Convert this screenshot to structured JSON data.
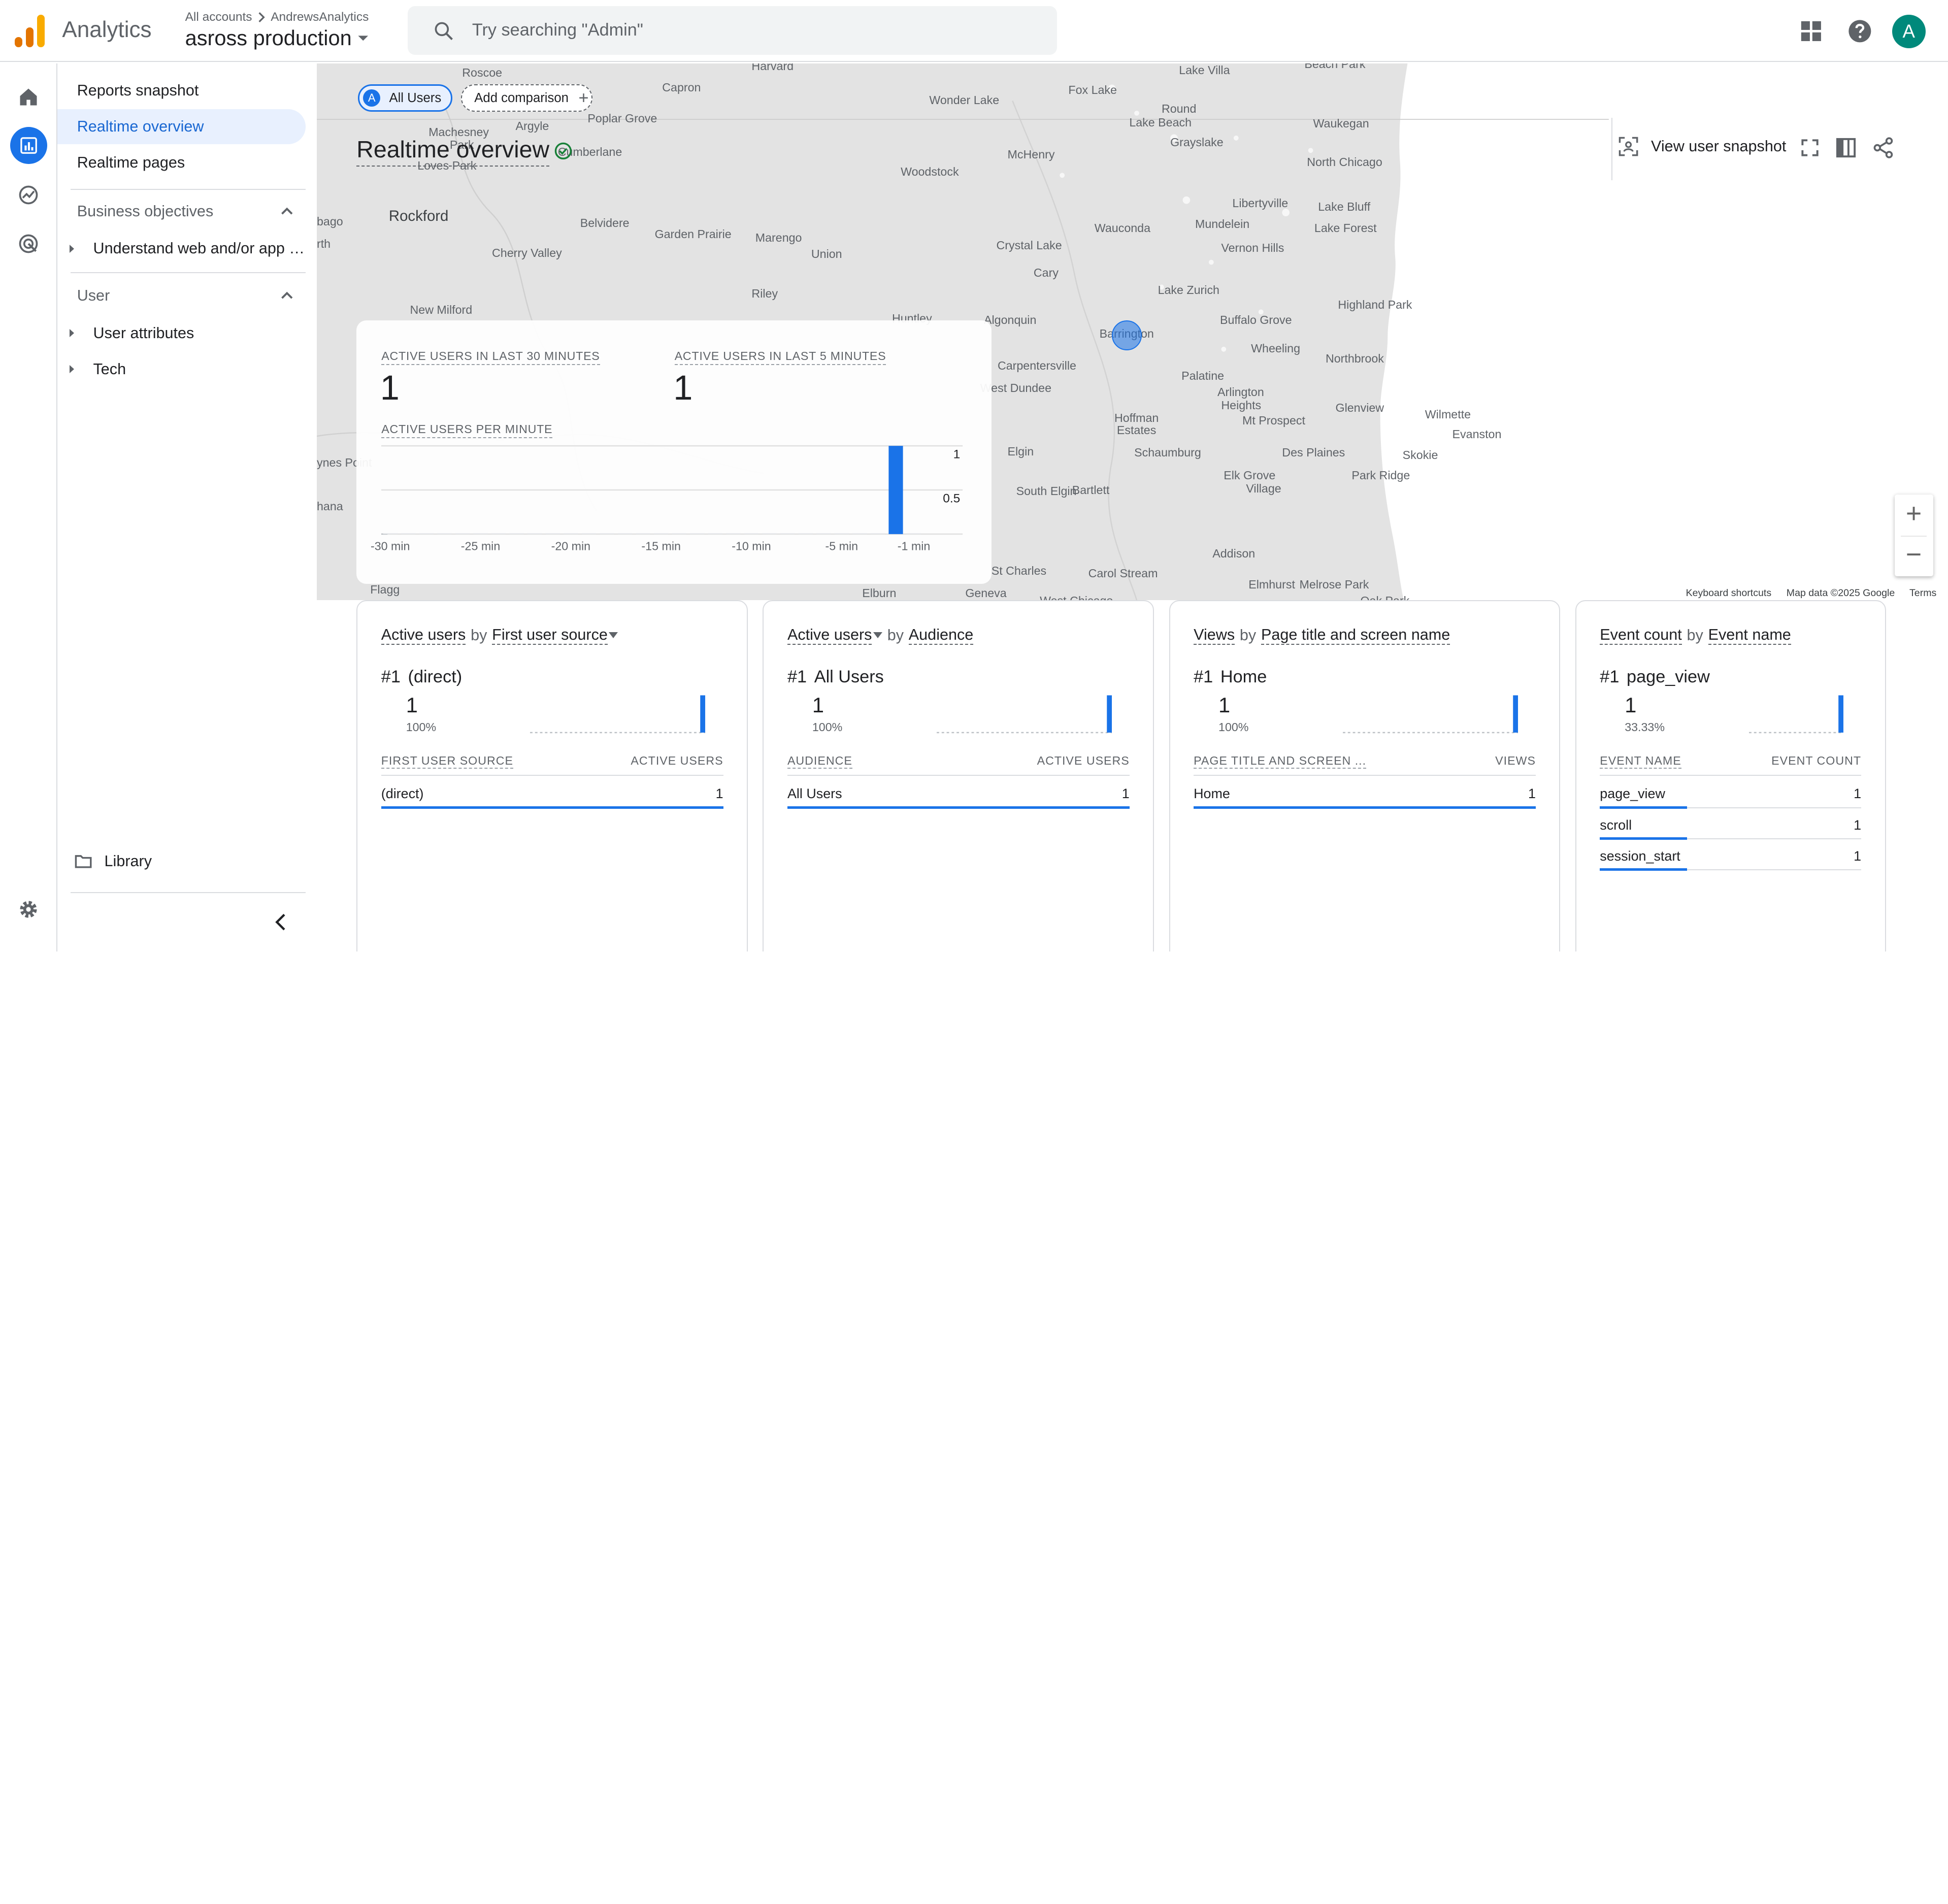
{
  "header": {
    "app_name": "Analytics",
    "breadcrumb_root": "All accounts",
    "breadcrumb_account": "AndrewsAnalytics",
    "property_name": "asross production",
    "search_placeholder": "Try searching \"Admin\"",
    "avatar_initial": "A",
    "icons": [
      "apps-grid-icon",
      "help-icon"
    ]
  },
  "rail": {
    "items": [
      "home-icon",
      "reports-icon",
      "explore-icon",
      "advertising-icon"
    ],
    "active": "reports-icon",
    "settings_icon": "gear-icon"
  },
  "nav": {
    "items": [
      "Reports snapshot",
      "Realtime overview",
      "Realtime pages"
    ],
    "active": "Realtime overview",
    "business_section": "Business objectives",
    "business_sub": [
      "Understand web and/or app t..."
    ],
    "user_section": "User",
    "user_sub": [
      "User attributes",
      "Tech"
    ],
    "library": "Library"
  },
  "comparison": {
    "segment_badge": "A",
    "segment": "All Users",
    "add": "Add comparison"
  },
  "page": {
    "title": "Realtime overview",
    "snapshot_button": "View user snapshot"
  },
  "map": {
    "labels": [
      {
        "t": "Harvard"
      },
      {
        "t": "Roscoe"
      },
      {
        "t": "Capron"
      },
      {
        "t": "Wonder Lake"
      },
      {
        "t": "Fox Lake"
      },
      {
        "t": "Lake Villa"
      },
      {
        "t": "Beach Park"
      },
      {
        "t": "Poplar Grove"
      },
      {
        "t": "Machesney"
      },
      {
        "t": "Argyle"
      },
      {
        "t": "Park"
      },
      {
        "t": "Round"
      },
      {
        "t": "Lake Beach"
      },
      {
        "t": "Waukegan"
      },
      {
        "t": "Grayslake"
      },
      {
        "t": "Cumberlane"
      },
      {
        "t": "Loves Park"
      },
      {
        "t": "McHenry"
      },
      {
        "t": "North Chicago"
      },
      {
        "t": "Woodstock"
      },
      {
        "t": "Rockford"
      },
      {
        "t": "Libertyville"
      },
      {
        "t": "Lake Bluff"
      },
      {
        "t": "Belvidere"
      },
      {
        "t": "Garden Prairie"
      },
      {
        "t": "Wauconda"
      },
      {
        "t": "Mundelein"
      },
      {
        "t": "Lake Forest"
      },
      {
        "t": "Marengo"
      },
      {
        "t": "Crystal Lake"
      },
      {
        "t": "Vernon Hills"
      },
      {
        "t": "Cherry Valley"
      },
      {
        "t": "Union"
      },
      {
        "t": "Cary"
      },
      {
        "t": "Lake Zurich"
      },
      {
        "t": "Riley"
      },
      {
        "t": "Highland Park"
      },
      {
        "t": "New Milford"
      },
      {
        "t": "Huntley"
      },
      {
        "t": "Algonquin"
      },
      {
        "t": "Buffalo Grove"
      },
      {
        "t": "Barrington"
      },
      {
        "t": "Wheeling"
      },
      {
        "t": "Northbrook"
      },
      {
        "t": "Carpentersville"
      },
      {
        "t": "Palatine"
      },
      {
        "t": "West Dundee"
      },
      {
        "t": "Arlington"
      },
      {
        "t": "Heights"
      },
      {
        "t": "Glenview"
      },
      {
        "t": "Wilmette"
      },
      {
        "t": "Hoffman"
      },
      {
        "t": "Estates"
      },
      {
        "t": "Mt Prospect"
      },
      {
        "t": "Evanston"
      },
      {
        "t": "Elgin"
      },
      {
        "t": "Schaumburg"
      },
      {
        "t": "Des Plaines"
      },
      {
        "t": "Skokie"
      },
      {
        "t": "Park Ridge"
      },
      {
        "t": "Elk Grove"
      },
      {
        "t": "Village"
      },
      {
        "t": "South Elgin"
      },
      {
        "t": "Bartlett"
      },
      {
        "t": "Addison"
      },
      {
        "t": "St Charles"
      },
      {
        "t": "Carol Stream"
      },
      {
        "t": "Elmhurst"
      },
      {
        "t": "Melrose Park"
      },
      {
        "t": "Elburn"
      },
      {
        "t": "Geneva"
      },
      {
        "t": "West Chicago"
      },
      {
        "t": "Oak Park"
      },
      {
        "t": "Flagg"
      },
      {
        "t": "ynes Point"
      },
      {
        "t": "hana"
      },
      {
        "t": "bago"
      },
      {
        "t": "rth"
      }
    ],
    "footer_shortcuts": "Keyboard shortcuts",
    "footer_data": "Map data ©2025 Google",
    "footer_terms": "Terms",
    "zoom_in": "+",
    "zoom_out": "−"
  },
  "realtime": {
    "label_30": "ACTIVE USERS IN LAST 30 MINUTES",
    "value_30": "1",
    "label_5": "ACTIVE USERS IN LAST 5 MINUTES",
    "value_5": "1",
    "label_per_minute": "ACTIVE USERS PER MINUTE",
    "colors": {
      "bar": "#1a73e8"
    }
  },
  "chart_data": {
    "type": "bar",
    "x_ticks": [
      "-30 min",
      "-25 min",
      "-20 min",
      "-15 min",
      "-10 min",
      "-5 min",
      "-1 min"
    ],
    "x": [
      -30,
      -29,
      -28,
      -27,
      -26,
      -25,
      -24,
      -23,
      -22,
      -21,
      -20,
      -19,
      -18,
      -17,
      -16,
      -15,
      -14,
      -13,
      -12,
      -11,
      -10,
      -9,
      -8,
      -7,
      -6,
      -5,
      -4,
      -3,
      -2,
      -1
    ],
    "values": [
      0,
      0,
      0,
      0,
      0,
      0,
      0,
      0,
      0,
      0,
      0,
      0,
      0,
      0,
      0,
      0,
      0,
      0,
      0,
      0,
      0,
      0,
      0,
      0,
      0,
      0,
      0,
      0,
      1,
      0
    ],
    "y_ticks": [
      "1",
      "0.5"
    ],
    "ylim": [
      0,
      1
    ],
    "xlabel": "",
    "ylabel": ""
  },
  "cards": [
    {
      "title_metric": "Active users",
      "title_by": "by",
      "title_dim": "First user source",
      "caret_on": "dim",
      "rank": "#1",
      "top_name": "(direct)",
      "top_value": "1",
      "top_pct": "100%",
      "col_left": "FIRST USER SOURCE",
      "col_right": "ACTIVE USERS",
      "rows": [
        {
          "name": "(direct)",
          "value": "1",
          "share": 1
        }
      ]
    },
    {
      "title_metric": "Active users",
      "title_by": "by",
      "title_dim": "Audience",
      "caret_on": "metric",
      "rank": "#1",
      "top_name": "All Users",
      "top_value": "1",
      "top_pct": "100%",
      "col_left": "AUDIENCE",
      "col_right": "ACTIVE USERS",
      "rows": [
        {
          "name": "All Users",
          "value": "1",
          "share": 1
        }
      ]
    },
    {
      "title_metric": "Views",
      "title_by": "by",
      "title_dim": "Page title and screen name",
      "caret_on": "none",
      "rank": "#1",
      "top_name": "Home",
      "top_value": "1",
      "top_pct": "100%",
      "col_left": "PAGE TITLE AND SCREEN ...",
      "col_right": "VIEWS",
      "rows": [
        {
          "name": "Home",
          "value": "1",
          "share": 1
        }
      ]
    },
    {
      "title_metric": "Event count",
      "title_by": "by",
      "title_dim": "Event name",
      "caret_on": "none",
      "rank": "#1",
      "top_name": "page_view",
      "top_value": "1",
      "top_pct": "33.33%",
      "col_left": "EVENT NAME",
      "col_right": "EVENT COUNT",
      "rows": [
        {
          "name": "page_view",
          "value": "1",
          "share": 0.3333
        },
        {
          "name": "scroll",
          "value": "1",
          "share": 0.3333
        },
        {
          "name": "session_start",
          "value": "1",
          "share": 0.3333
        }
      ]
    }
  ]
}
